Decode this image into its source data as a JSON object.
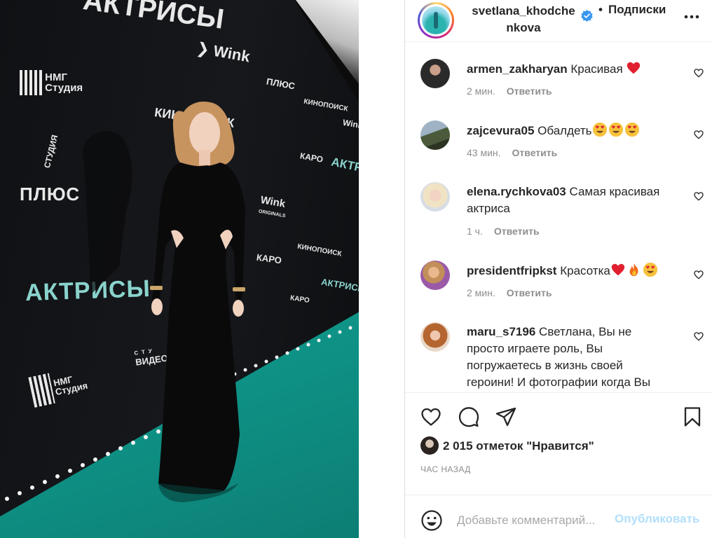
{
  "photo": {
    "backdrop_logos": {
      "nmg_studio": "НМГ\nСтудия",
      "wink": "Wink",
      "plus": "ПЛЮС",
      "studio_vertical": "СТУДИЯ",
      "kinopoisk": "КИНОПОИСК",
      "actresses": "АКТРИСЫ",
      "karo": "КАРО",
      "wink_originals": "Wink",
      "originals": "ORIGINALS",
      "videoprokat": "ВИДЕОП",
      "studio_small": "СТУ"
    }
  },
  "header": {
    "username_line1": "svetlana_khodche",
    "username_line2": "nkova",
    "separator": "•",
    "follow_label": "Подписки"
  },
  "comments": [
    {
      "username": "armen_zakharyan",
      "text": "Красивая",
      "emojis": [
        "heart"
      ],
      "age": "2 мин.",
      "reply": "Ответить"
    },
    {
      "username": "zajcevura05",
      "text": "Обалдеть",
      "emojis": [
        "heart-eyes",
        "heart-eyes",
        "heart-eyes"
      ],
      "age": "43 мин.",
      "reply": "Ответить"
    },
    {
      "username": "elena.rychkova03",
      "text": "Самая красивая",
      "text_line2": "актриса",
      "emojis": [],
      "age": "1 ч.",
      "reply": "Ответить"
    },
    {
      "username": "presidentfripkst",
      "text": "Красотка",
      "emojis": [
        "heart",
        "fire",
        "heart-eyes"
      ],
      "age": "2 мин.",
      "reply": "Ответить"
    },
    {
      "username": "maru_s7196",
      "text": "Светлана, Вы не",
      "text_line2": "просто играете роль, Вы",
      "text_line3": "погружаетесь в жизнь своей",
      "text_line4": "героини! И фотографии когда Вы",
      "emojis": []
    }
  ],
  "actions": {
    "likes_text": "2 015 отметок \"Нравится\"",
    "time_ago": "ЧАС НАЗАД",
    "comment_placeholder": "Добавьте комментарий...",
    "publish_label": "Опубликовать"
  },
  "colors": {
    "verified": "#3897f0",
    "heart_red": "#ed4956",
    "publish_disabled": "#b2dffc",
    "meta_gray": "#8e8e8e",
    "floor_teal": "#10a293"
  }
}
